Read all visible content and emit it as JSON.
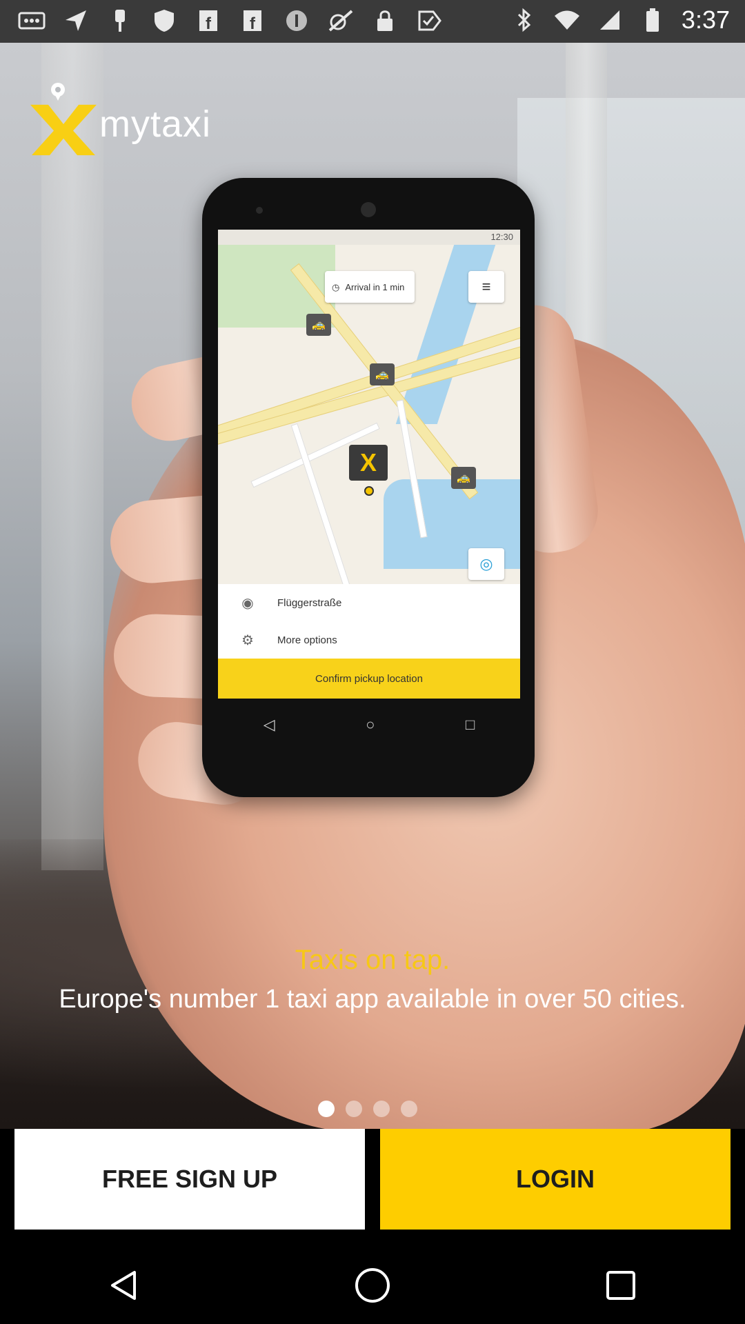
{
  "status_bar": {
    "time": "3:37",
    "left_icons": [
      "more-icon",
      "send-icon",
      "pin-icon",
      "shield-icon",
      "facebook-icon",
      "facebook-icon",
      "circle-pause-icon",
      "fake-gps-icon",
      "lock-icon",
      "check-flag-icon"
    ],
    "right_icons": [
      "bluetooth-icon",
      "wifi-icon",
      "signal-icon",
      "battery-icon"
    ]
  },
  "logo": {
    "text": "mytaxi"
  },
  "phone_mockup": {
    "status_time": "12:30",
    "arrival_text": "Arrival in 1 min",
    "address": "Flüggerstraße",
    "more_options": "More options",
    "confirm": "Confirm pickup location"
  },
  "promo": {
    "tagline": "Taxis on tap.",
    "subline": "Europe's number 1 taxi app available in over 50 cities."
  },
  "pager": {
    "count": 4,
    "active_index": 0
  },
  "buttons": {
    "signup": "FREE SIGN UP",
    "login": "LOGIN"
  },
  "colors": {
    "accent": "#FECD00",
    "tagline": "#F7C816"
  }
}
